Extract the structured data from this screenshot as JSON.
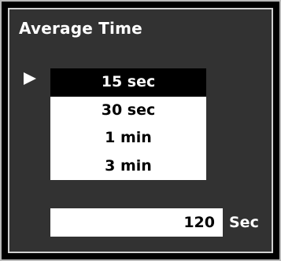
{
  "panel": {
    "title": "Average Time"
  },
  "options": [
    {
      "label": "15 sec",
      "selected": true
    },
    {
      "label": "30 sec",
      "selected": false
    },
    {
      "label": "1 min",
      "selected": false
    },
    {
      "label": "3 min",
      "selected": false
    }
  ],
  "custom": {
    "value": "120",
    "unit": "Sec"
  },
  "icons": {
    "pointer": "play-arrow-icon"
  },
  "colors": {
    "background": "#323232",
    "selected_bg": "#000000",
    "list_bg": "#ffffff",
    "text_light": "#ffffff",
    "text_dark": "#000000"
  }
}
